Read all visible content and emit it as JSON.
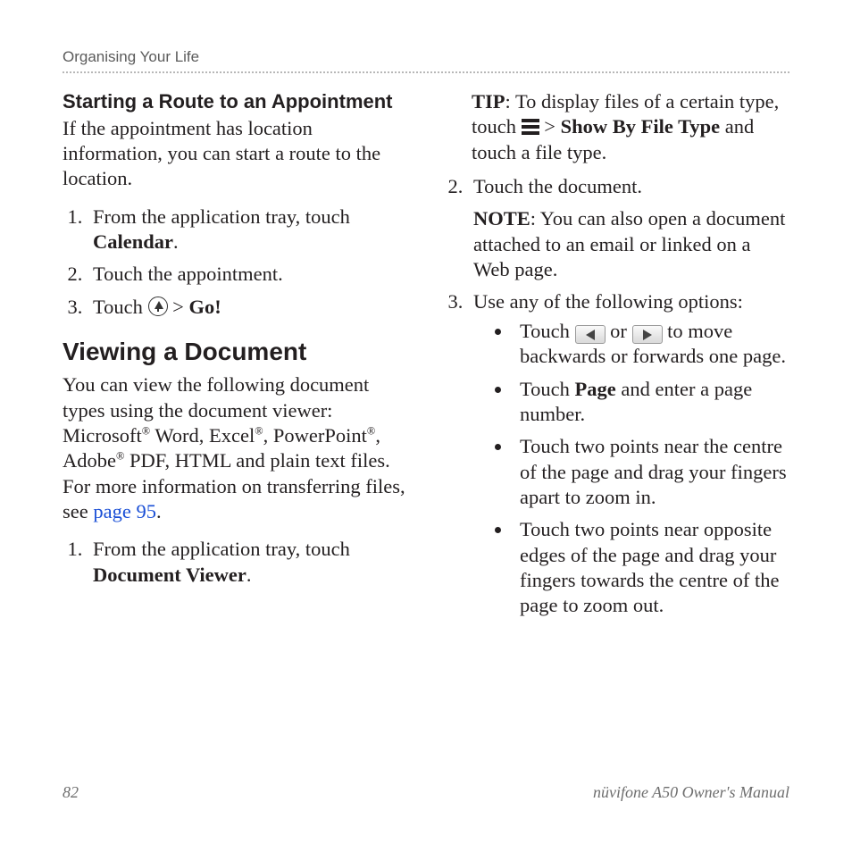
{
  "header": {
    "running": "Organising Your Life"
  },
  "left": {
    "h3": "Starting a Route to an Appointment",
    "intro": "If the appointment has location information, you can start a route to the location.",
    "steps": {
      "s1a": "From the application tray, touch ",
      "s1b": "Calendar",
      "s1c": ".",
      "s2": "Touch the appointment.",
      "s3a": "Touch ",
      "s3b": " > ",
      "s3c": "Go!"
    },
    "h2": "Viewing a Document",
    "doc_intro_a": "You can view the following document types using the document viewer: Microsoft",
    "doc_intro_b": " Word, Excel",
    "doc_intro_c": ", PowerPoint",
    "doc_intro_d": ", Adobe",
    "doc_intro_e": " PDF, HTML and plain text files. For more information on transferring files, see ",
    "doc_intro_link": "page 95",
    "doc_intro_f": ".",
    "doc_s1a": "From the application tray, touch ",
    "doc_s1b": "Document Viewer",
    "doc_s1c": "."
  },
  "right": {
    "tip_label": "TIP",
    "tip_a": ": To display files of a certain type, touch ",
    "tip_b": " > ",
    "tip_c": "Show By File Type",
    "tip_d": " and touch a file type.",
    "s2": "Touch the document.",
    "note_label": "NOTE",
    "note_body": ": You can also open a document attached to an email or linked on a Web page.",
    "s3": "Use any of the following options:",
    "b1a": "Touch ",
    "b1b": " or ",
    "b1c": " to move backwards or forwards one page.",
    "b2a": "Touch ",
    "b2b": "Page",
    "b2c": " and enter a page number.",
    "b3": "Touch two points near the centre of the page and drag your fingers apart to zoom in.",
    "b4": "Touch two points near opposite edges of the page and drag your fingers towards the centre of the page to zoom out."
  },
  "footer": {
    "page_number": "82",
    "manual_title": "nüvifone A50 Owner's Manual"
  }
}
